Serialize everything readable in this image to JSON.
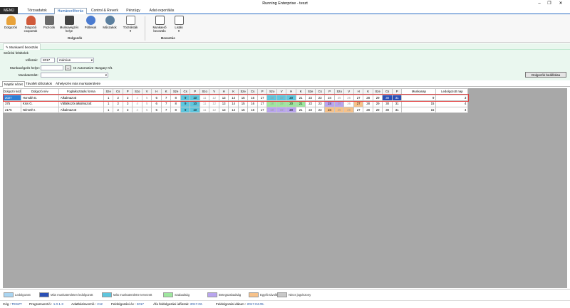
{
  "window": {
    "title": "Running Enterprise - teszt"
  },
  "menu": {
    "menu_label": "MENÜ",
    "tabs": [
      "Törzsadatok",
      "Humánerőforrás",
      "Control & Reverk",
      "Pénzügy",
      "Adat exportálás"
    ],
    "active_tab": 1
  },
  "ribbon": {
    "buttons": [
      {
        "label": "Dolgozók",
        "icon": "worker-icon",
        "color": "#e8a23a"
      },
      {
        "label": "Dolgozói csoportok",
        "icon": "worker-group-icon",
        "color": "#d05a3a"
      },
      {
        "label": "Pozíciók",
        "icon": "position-icon",
        "color": "#6a6a6a"
      },
      {
        "label": "Munkavégzés helye",
        "icon": "workplace-icon",
        "color": "#444444"
      },
      {
        "label": "Pótlékok",
        "icon": "allowance-icon",
        "color": "#4a7bd0"
      },
      {
        "label": "Műszakok",
        "icon": "shift-icon",
        "color": "#5b7f9e"
      },
      {
        "label": "Törzslisták",
        "icon": "master-list-icon",
        "color": "#777777"
      },
      {
        "label": "Munkaerő beosztás",
        "icon": "schedule-icon",
        "color": "#5a5a5a"
      },
      {
        "label": "Listák",
        "icon": "list-icon",
        "color": "#6a6a6a"
      }
    ],
    "groups": [
      "Dolgozók",
      "Beosztás"
    ]
  },
  "doc_tab": {
    "label": "Munkaerő beosztás"
  },
  "filters": {
    "section_title": "Szűrési feltételek",
    "period_label": "Időszak:",
    "year": "2017",
    "month": "március",
    "workplace_label": "Munkavégzés helye:",
    "workplace_value": "IS Automotive Hungary Kft.",
    "workplace_button": "...",
    "workarea_label": "Munkaterület:",
    "workarea_value": "",
    "settings_button": "Dolgozók beállítása"
  },
  "subtabs": [
    "Naptár nézet",
    "Távollét időszakok",
    "Áthelyezés más munkaterületre"
  ],
  "grid": {
    "headers": {
      "id": "Dolgozó kód",
      "name": "Dolgozó név",
      "employment": "Foglalkoztatás forma",
      "workdays": "Munkanap",
      "leave": "Ledolgozott nap"
    },
    "day_names": [
      "Sze",
      "Cs",
      "P",
      "Szo",
      "V",
      "H",
      "K",
      "Sze",
      "Cs",
      "P",
      "Szo",
      "V",
      "H",
      "K",
      "Sze",
      "Cs",
      "P",
      "Szo",
      "V",
      "H",
      "K",
      "Sze",
      "Cs",
      "P",
      "Szo",
      "V",
      "H",
      "K",
      "Sze",
      "Cs",
      "P"
    ],
    "rows": [
      {
        "id": "2027",
        "name": "Horváth E.",
        "employment": "Alkalmazott",
        "workdays": "9",
        "leave": "3"
      },
      {
        "id": "375",
        "name": "Kiss G.",
        "employment": "Vállalkozói alkalmazott",
        "workdays": "15",
        "leave": "4"
      },
      {
        "id": "2175",
        "name": "Németh I.",
        "employment": "Alkalmazott",
        "workdays": "15",
        "leave": "4"
      }
    ]
  },
  "legend": [
    {
      "label": "Ledolgozott",
      "color": "#a9d5f2"
    },
    {
      "label": "Más munkaterületen ledolgozott",
      "color": "#2a4fb5"
    },
    {
      "label": "Más munkaterületre tervezett",
      "color": "#5ec6de"
    },
    {
      "label": "Szabadság",
      "color": "#9ee79e"
    },
    {
      "label": "Betegszabadság",
      "color": "#b9a5ef"
    },
    {
      "label": "Egyéb távollét",
      "color": "#f7c28a"
    },
    {
      "label": "Nincs jogviszony",
      "color": "#c8c8c8"
    }
  ],
  "status": {
    "company_label": "Cég :",
    "company": "TESZT",
    "program_label": "Programverzió :",
    "program": "1.0.1.3",
    "db_label": "Adatbázisverzió :",
    "db": "212",
    "year_label": "Feldolgozási év :",
    "year": "2017",
    "vat_label": "Áfa feldolgozási időszak:",
    "vat": "2017.02.",
    "date_label": "Feldolgozási dátum :",
    "date": "2017.04.05."
  }
}
